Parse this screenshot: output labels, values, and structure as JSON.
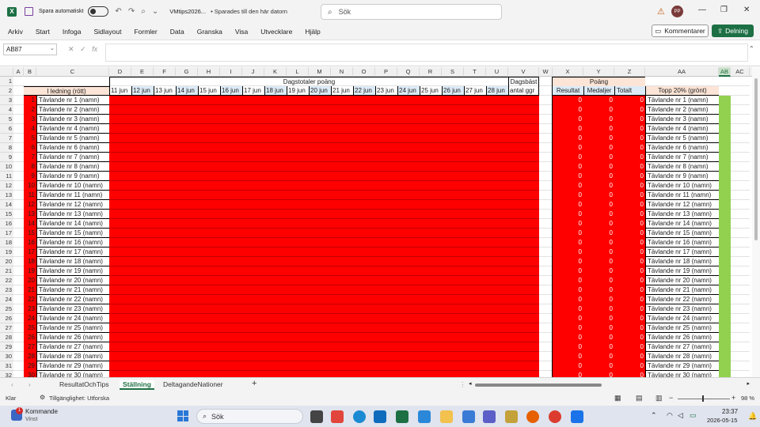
{
  "titlebar": {
    "autosave_label": "Spara automatiskt",
    "doc_title": "VMtips2026...",
    "doc_status": "• Sparades till den här datorn",
    "search_placeholder": "Sök",
    "user_initials": "PP"
  },
  "menu": [
    "Arkiv",
    "Start",
    "Infoga",
    "Sidlayout",
    "Formler",
    "Data",
    "Granska",
    "Visa",
    "Utvecklare",
    "Hjälp"
  ],
  "buttons": {
    "comments": "Kommentarer",
    "share": "Delning"
  },
  "formula": {
    "namebox": "AB87",
    "value": ""
  },
  "columns": [
    {
      "letter": "A",
      "w": 13
    },
    {
      "letter": "B",
      "w": 16
    },
    {
      "letter": "C",
      "w": 92
    },
    {
      "letter": "D",
      "w": 28
    },
    {
      "letter": "E",
      "w": 28
    },
    {
      "letter": "F",
      "w": 28
    },
    {
      "letter": "G",
      "w": 28
    },
    {
      "letter": "H",
      "w": 28
    },
    {
      "letter": "I",
      "w": 28
    },
    {
      "letter": "J",
      "w": 28
    },
    {
      "letter": "K",
      "w": 28
    },
    {
      "letter": "L",
      "w": 28
    },
    {
      "letter": "M",
      "w": 28
    },
    {
      "letter": "N",
      "w": 28
    },
    {
      "letter": "O",
      "w": 28
    },
    {
      "letter": "P",
      "w": 28
    },
    {
      "letter": "Q",
      "w": 28
    },
    {
      "letter": "R",
      "w": 28
    },
    {
      "letter": "S",
      "w": 28
    },
    {
      "letter": "T",
      "w": 28
    },
    {
      "letter": "U",
      "w": 28
    },
    {
      "letter": "V",
      "w": 39
    },
    {
      "letter": "W",
      "w": 17
    },
    {
      "letter": "X",
      "w": 39
    },
    {
      "letter": "Y",
      "w": 39
    },
    {
      "letter": "Z",
      "w": 39
    },
    {
      "letter": "AA",
      "w": 93
    },
    {
      "letter": "AB",
      "w": 15
    },
    {
      "letter": "AC",
      "w": 24
    }
  ],
  "selected_column": "AB",
  "headers": {
    "leader": "I ledning (rött)",
    "daily_totals": "Dagstotaler poäng",
    "daily_best": "Dagsbäst",
    "daily_best_sub": "antal ggr",
    "points": "Poäng",
    "result": "Resultat",
    "medals": "Medaljer",
    "total": "Totalt",
    "top20": "Topp 20% (grönt)"
  },
  "days": [
    "11 jun",
    "12 jun",
    "13 jun",
    "14 jun",
    "15 jun",
    "16 jun",
    "17 jun",
    "18 jun",
    "19 jun",
    "20 jun",
    "21 jun",
    "22 jun",
    "23 jun",
    "24 jun",
    "25 jun",
    "26 jun",
    "27 jun",
    "28 jun"
  ],
  "rows": [
    {
      "rn": "3",
      "b": "1",
      "name": "Tävlande nr 1 (namn)"
    },
    {
      "rn": "4",
      "b": "2",
      "name": "Tävlande nr 2 (namn)"
    },
    {
      "rn": "5",
      "b": "3",
      "name": "Tävlande nr 3 (namn)"
    },
    {
      "rn": "6",
      "b": "4",
      "name": "Tävlande nr 4 (namn)"
    },
    {
      "rn": "7",
      "b": "5",
      "name": "Tävlande nr 5 (namn)"
    },
    {
      "rn": "8",
      "b": "6",
      "name": "Tävlande nr 6 (namn)"
    },
    {
      "rn": "9",
      "b": "7",
      "name": "Tävlande nr 7 (namn)"
    },
    {
      "rn": "10",
      "b": "8",
      "name": "Tävlande nr 8 (namn)"
    },
    {
      "rn": "11",
      "b": "9",
      "name": "Tävlande nr 9 (namn)"
    },
    {
      "rn": "12",
      "b": "10",
      "name": "Tävlande nr 10 (namn)"
    },
    {
      "rn": "13",
      "b": "11",
      "name": "Tävlande nr 11 (namn)"
    },
    {
      "rn": "14",
      "b": "12",
      "name": "Tävlande nr 12 (namn)"
    },
    {
      "rn": "15",
      "b": "13",
      "name": "Tävlande nr 13 (namn)"
    },
    {
      "rn": "16",
      "b": "14",
      "name": "Tävlande nr 14 (namn)"
    },
    {
      "rn": "17",
      "b": "15",
      "name": "Tävlande nr 15 (namn)"
    },
    {
      "rn": "18",
      "b": "16",
      "name": "Tävlande nr 16 (namn)"
    },
    {
      "rn": "19",
      "b": "17",
      "name": "Tävlande nr 17 (namn)"
    },
    {
      "rn": "20",
      "b": "18",
      "name": "Tävlande nr 18 (namn)"
    },
    {
      "rn": "21",
      "b": "19",
      "name": "Tävlande nr 19 (namn)"
    },
    {
      "rn": "22",
      "b": "20",
      "name": "Tävlande nr 20 (namn)"
    },
    {
      "rn": "23",
      "b": "21",
      "name": "Tävlande nr 21 (namn)"
    },
    {
      "rn": "24",
      "b": "22",
      "name": "Tävlande nr 22 (namn)"
    },
    {
      "rn": "25",
      "b": "23",
      "name": "Tävlande nr 23 (namn)"
    },
    {
      "rn": "26",
      "b": "24",
      "name": "Tävlande nr 24 (namn)"
    },
    {
      "rn": "27",
      "b": "25",
      "name": "Tävlande nr 25 (namn)"
    },
    {
      "rn": "28",
      "b": "26",
      "name": "Tävlande nr 26 (namn)"
    },
    {
      "rn": "29",
      "b": "27",
      "name": "Tävlande nr 27 (namn)"
    },
    {
      "rn": "30",
      "b": "28",
      "name": "Tävlande nr 28 (namn)"
    },
    {
      "rn": "31",
      "b": "29",
      "name": "Tävlande nr 29 (namn)"
    },
    {
      "rn": "32",
      "b": "30",
      "name": "Tävlande nr 30 (namn)"
    }
  ],
  "zero_value": "0",
  "sheets": [
    "ResultatOchTips",
    "Ställning",
    "DeltagandeNationer"
  ],
  "active_sheet": "Ställning",
  "status": {
    "ready": "Klar",
    "accessibility": "Tillgänglighet: Utforska",
    "zoom": "98 %"
  },
  "taskbar": {
    "notification_title": "Kommande",
    "notification_sub": "Vinst",
    "notification_count": "1",
    "search": "Sök",
    "time": "23:37",
    "date": "2026-05-15"
  },
  "colors": {
    "red": "#ff0000",
    "green": "#92d050",
    "header_blue": "#dcebf7",
    "header_peach": "#fce4d6",
    "excel_green": "#1d7044"
  }
}
